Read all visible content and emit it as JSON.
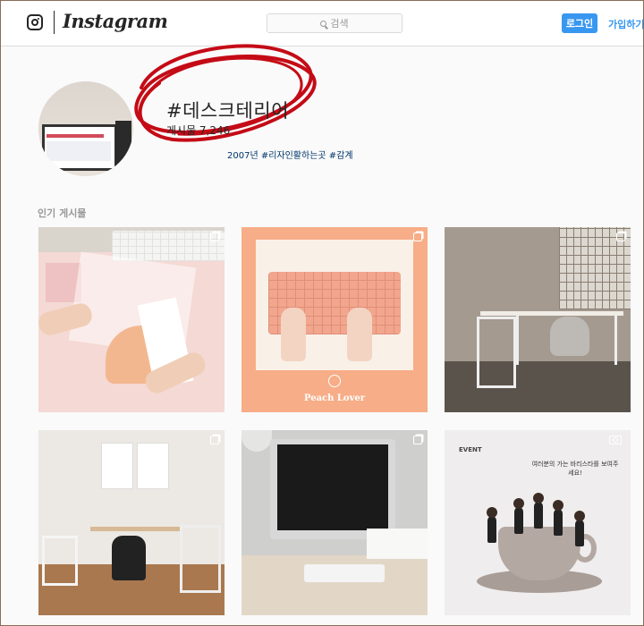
{
  "header": {
    "logo_text": "Instagram",
    "search": {
      "placeholder": "검색",
      "icon": "search-icon"
    },
    "login_label": "로그인",
    "signup_label": "가입하기",
    "accent_color": "#3897f0"
  },
  "profile": {
    "hashtag": "#데스크테리어",
    "post_count_text": "게시물 7,246",
    "related_text": "2007년 #리자인활하는곳 #감계"
  },
  "section": {
    "label": "인기 게시물"
  },
  "posts": [
    {
      "name": "post-1",
      "type": "multi"
    },
    {
      "name": "post-2",
      "type": "multi",
      "overlay_text": "Peach Lover"
    },
    {
      "name": "post-3",
      "type": "multi"
    },
    {
      "name": "post-4",
      "type": "multi"
    },
    {
      "name": "post-5",
      "type": "multi"
    },
    {
      "name": "post-6",
      "type": "video",
      "overlay_title": "EVENT",
      "overlay_text": "여러분의 가는 바리스타를 보여주세요!"
    }
  ]
}
